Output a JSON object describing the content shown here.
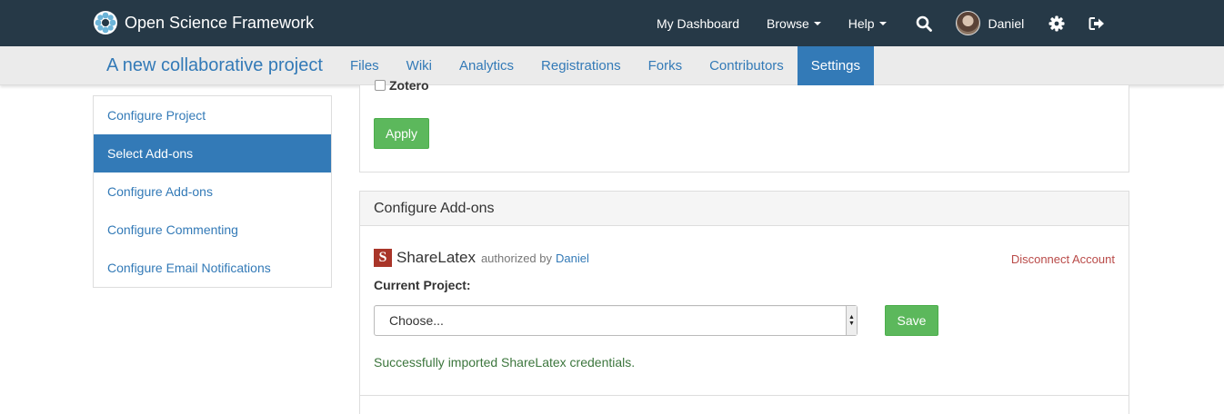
{
  "navbar": {
    "brand": "Open Science Framework",
    "items": [
      {
        "label": "My Dashboard"
      },
      {
        "label": "Browse"
      },
      {
        "label": "Help"
      }
    ],
    "user_name": "Daniel",
    "icons": [
      "search-icon",
      "gear-icon",
      "sign-out-icon"
    ]
  },
  "project": {
    "title": "A new collaborative project",
    "tabs": [
      {
        "label": "Files"
      },
      {
        "label": "Wiki"
      },
      {
        "label": "Analytics"
      },
      {
        "label": "Registrations"
      },
      {
        "label": "Forks"
      },
      {
        "label": "Contributors"
      },
      {
        "label": "Settings",
        "active": true
      }
    ]
  },
  "sidebar": {
    "items": [
      {
        "label": "Configure Project"
      },
      {
        "label": "Select Add-ons",
        "active": true
      },
      {
        "label": "Configure Add-ons"
      },
      {
        "label": "Configure Commenting"
      },
      {
        "label": "Configure Email Notifications"
      }
    ]
  },
  "select_addons": {
    "partial_item_label": "Zotero",
    "apply_label": "Apply"
  },
  "configure_addons": {
    "heading": "Configure Add-ons",
    "addon_name": "ShareLatex",
    "addon_logo_letter": "S",
    "authorized_by_text": "authorized by",
    "authorized_user": "Daniel",
    "disconnect_label": "Disconnect Account",
    "current_project_label": "Current Project:",
    "select_value": "Choose...",
    "save_label": "Save",
    "success_message": "Successfully imported ShareLatex credentials."
  },
  "colors": {
    "navbar_bg": "#263947",
    "accent": "#337ab7",
    "success_button": "#5cb85c",
    "danger_link": "#b94a48",
    "success_text": "#3c763d"
  }
}
